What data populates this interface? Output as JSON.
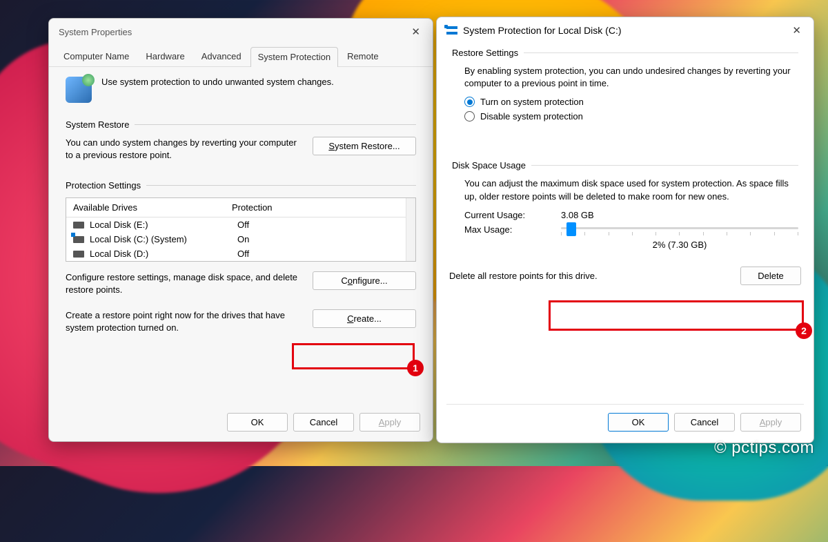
{
  "watermark": "© pctips.com",
  "left": {
    "title": "System Properties",
    "tabs": [
      "Computer Name",
      "Hardware",
      "Advanced",
      "System Protection",
      "Remote"
    ],
    "active_tab": "System Protection",
    "intro": "Use system protection to undo unwanted system changes.",
    "system_restore": {
      "heading": "System Restore",
      "desc": "You can undo system changes by reverting your computer to a previous restore point.",
      "button": "System Restore..."
    },
    "protection_settings": {
      "heading": "Protection Settings",
      "col_drives": "Available Drives",
      "col_prot": "Protection",
      "drives": [
        {
          "name": "Local Disk (E:)",
          "protection": "Off",
          "system": false
        },
        {
          "name": "Local Disk (C:) (System)",
          "protection": "On",
          "system": true
        },
        {
          "name": "Local Disk (D:)",
          "protection": "Off",
          "system": false
        }
      ],
      "configure_desc": "Configure restore settings, manage disk space, and delete restore points.",
      "configure_btn": "Configure...",
      "create_desc": "Create a restore point right now for the drives that have system protection turned on.",
      "create_btn": "Create..."
    },
    "footer": {
      "ok": "OK",
      "cancel": "Cancel",
      "apply": "Apply"
    }
  },
  "right": {
    "title": "System Protection for Local Disk (C:)",
    "restore": {
      "heading": "Restore Settings",
      "desc": "By enabling system protection, you can undo undesired changes by reverting your computer to a previous point in time.",
      "opt_on": "Turn on system protection",
      "opt_off": "Disable system protection",
      "selected": "on"
    },
    "disk": {
      "heading": "Disk Space Usage",
      "desc": "You can adjust the maximum disk space used for system protection. As space fills up, older restore points will be deleted to make room for new ones.",
      "current_label": "Current Usage:",
      "current_value": "3.08 GB",
      "max_label": "Max Usage:",
      "max_caption": "2% (7.30 GB)"
    },
    "delete": {
      "desc": "Delete all restore points for this drive.",
      "button": "Delete"
    },
    "footer": {
      "ok": "OK",
      "cancel": "Cancel",
      "apply": "Apply"
    }
  },
  "annotations": {
    "one": "1",
    "two": "2"
  }
}
